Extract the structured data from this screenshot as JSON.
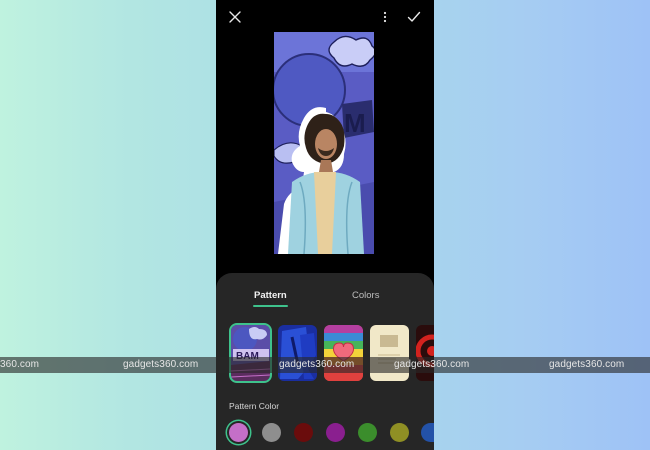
{
  "editor": {
    "close_icon": "close-icon",
    "more_icon": "more-vertical-icon",
    "confirm_icon": "check-icon"
  },
  "preview": {
    "subject": "person cutout with white sticker outline over comic pattern background",
    "pattern_text": "BAM"
  },
  "sheet": {
    "tabs": [
      {
        "label": "Pattern",
        "active": true
      },
      {
        "label": "Colors",
        "active": false
      }
    ],
    "patterns": [
      {
        "name": "comic-bam",
        "selected": true
      },
      {
        "name": "blue-brush",
        "selected": false
      },
      {
        "name": "rainbow-heart",
        "selected": false
      },
      {
        "name": "vintage-paper",
        "selected": false
      },
      {
        "name": "red-swirl",
        "selected": false
      }
    ],
    "pattern_color_label": "Pattern Color",
    "pattern_colors": [
      {
        "color": "#c46fc8",
        "selected": true
      },
      {
        "color": "#8e8e8e",
        "selected": false
      },
      {
        "color": "#6a0c0c",
        "selected": false
      },
      {
        "color": "#8a1f8f",
        "selected": false
      },
      {
        "color": "#3b8d2c",
        "selected": false
      },
      {
        "color": "#8f8f24",
        "selected": false
      },
      {
        "color": "#2352a8",
        "selected": false
      }
    ]
  },
  "watermark": {
    "items": [
      "360.com",
      "gadgets360.com",
      "gadgets360.com",
      "gadgets360.com",
      "gadgets360.com"
    ]
  },
  "colors": {
    "accent": "#3ec28c",
    "sheet_bg": "#262626",
    "app_bg": "#000000"
  }
}
